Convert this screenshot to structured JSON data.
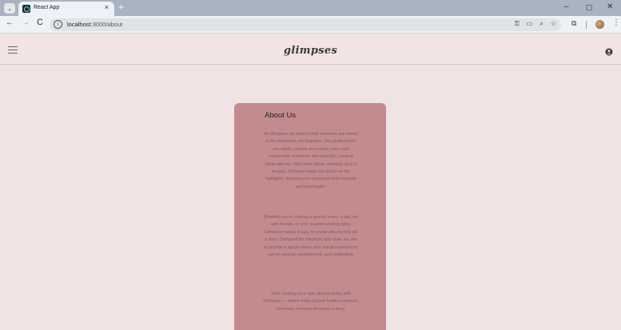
{
  "browser": {
    "tab_title": "React App",
    "tab_close": "×",
    "new_tab": "+",
    "url_host": "localhost",
    "url_path": ":3000/about",
    "controls": {
      "minimize": "–",
      "maximize": "▢",
      "close": "✕"
    },
    "nav": {
      "back": "←",
      "forward": "→",
      "reload": "C"
    },
    "menu_glyph": "⋮"
  },
  "header": {
    "brand": "glimpses",
    "menu_icon": "hamburger-icon",
    "account_icon": "account-circle-icon"
  },
  "about": {
    "title": "About Us",
    "paragraphs": [
      "At Glimpses, we believe that moments are meant to be cherished, not forgotten. Our platform lets you easily capture and curate your most memorable memories into beautiful, curated photo albums. With each album allowing up to 5 images, Glimpses helps you focus on the highlights, keeping your memories both intimate and meaningful.",
      "Whether you're sharing a special event, a day out with friends, or your creative photography, Glimpses makes it easy to create albums that tell a story. Designed for simplicity and style, we aim to provide a space where your visual experiences can be shared, remembered, and celebrated.",
      "Start creating your own albums today with Glimpses — where every picture holds a moment, and every moment becomes a story."
    ]
  },
  "colors": {
    "page_bg": "#efe3e3",
    "header_bg": "#f3e4e4",
    "card_bg": "#c48b8e"
  }
}
